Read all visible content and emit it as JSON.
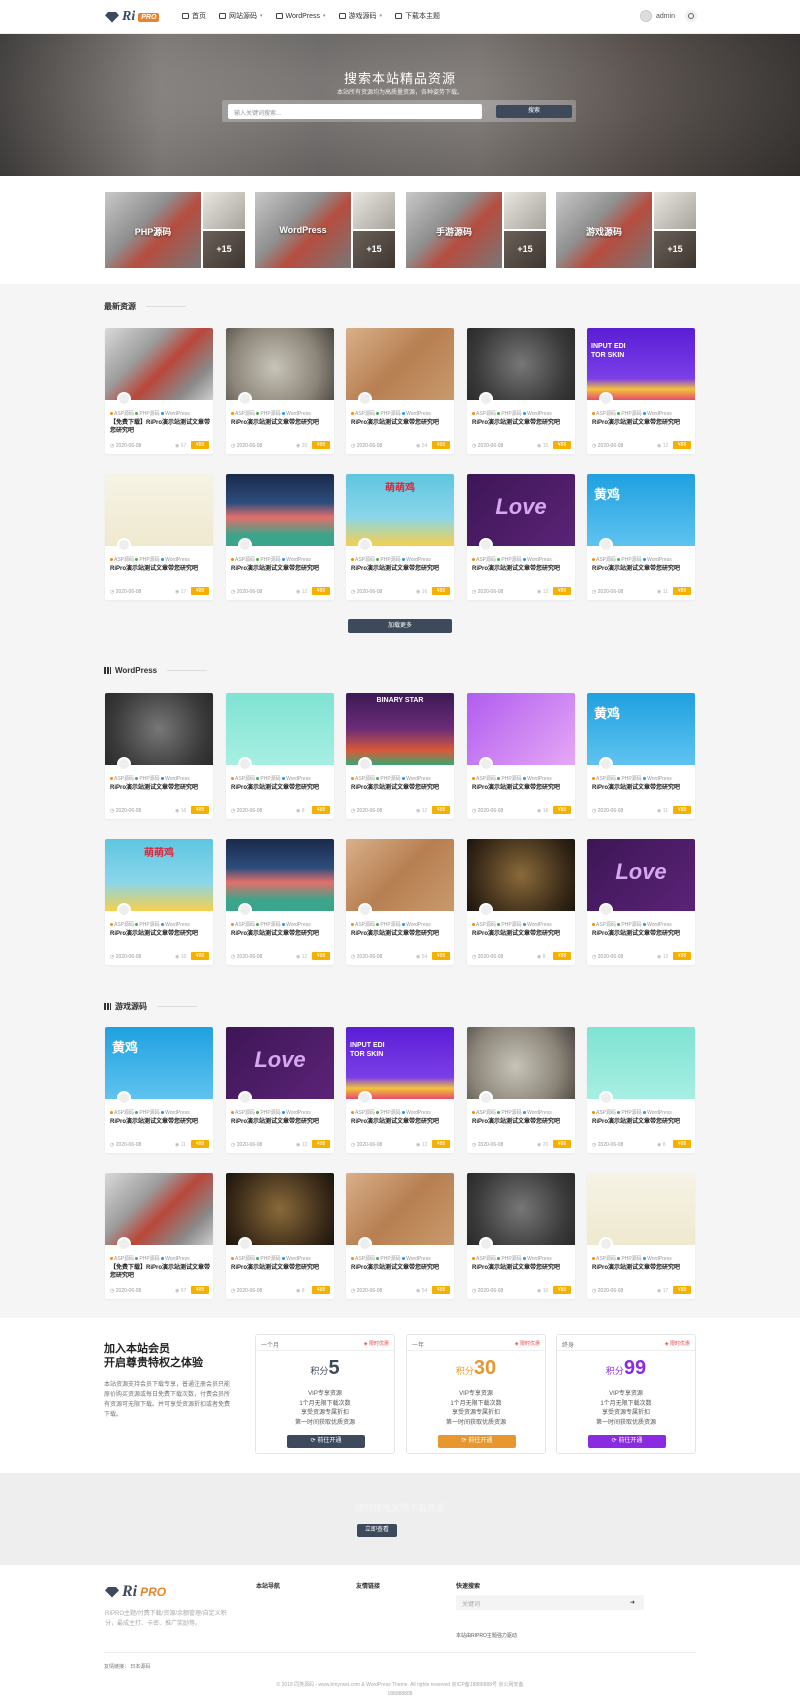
{
  "header": {
    "logo_text": "Ri",
    "logo_badge": "PRO",
    "nav": [
      {
        "label": "首页",
        "icon": "monitor-icon",
        "caret": false
      },
      {
        "label": "网站源码",
        "icon": "code-icon",
        "caret": true
      },
      {
        "label": "WordPress",
        "icon": "wordpress-icon",
        "caret": true
      },
      {
        "label": "游戏源码",
        "icon": "game-icon",
        "caret": true
      },
      {
        "label": "下载本主题",
        "icon": "pin-icon",
        "caret": false
      }
    ],
    "user": "admin"
  },
  "hero": {
    "title": "搜索本站精品资源",
    "subtitle": "本站所有资源均为高质量资源，各种姿势下载。",
    "search_placeholder": "输入关键词搜索...",
    "search_button": "搜索"
  },
  "categories": [
    {
      "name": "PHP源码",
      "more": "+15"
    },
    {
      "name": "WordPress",
      "more": "+15"
    },
    {
      "name": "手游源码",
      "more": "+15"
    },
    {
      "name": "游戏源码",
      "more": "+15"
    }
  ],
  "sections": {
    "latest": "最新资源",
    "wordpress": "WordPress",
    "games": "游戏源码",
    "load_more": "加载更多"
  },
  "card_common": {
    "tags": [
      "ASP源码",
      "PHP源码",
      "WordPress"
    ],
    "title": "RiPro演示站测试文章带您研究吧",
    "title_free": "【免费下载】RiPro演示站测试文章带您研究吧",
    "date": "2020-06-08"
  },
  "latest_cards": [
    {
      "thumb": "cans",
      "free": true,
      "views": "67",
      "price": "88"
    },
    {
      "thumb": "stamp",
      "free": false,
      "views": "20",
      "price": "88"
    },
    {
      "thumb": "wood",
      "free": false,
      "views": "54",
      "price": "88"
    },
    {
      "thumb": "emblem",
      "free": false,
      "views": "10",
      "price": "88"
    },
    {
      "thumb": "editor",
      "free": false,
      "views": "12",
      "price": "88"
    },
    {
      "thumb": "pear",
      "free": false,
      "views": "17",
      "price": "88"
    },
    {
      "thumb": "mountain",
      "free": false,
      "views": "12",
      "price": "88"
    },
    {
      "thumb": "chick",
      "free": false,
      "views": "16",
      "price": "88"
    },
    {
      "thumb": "love",
      "free": false,
      "views": "12",
      "price": "88"
    },
    {
      "thumb": "yellowchick",
      "free": false,
      "views": "11",
      "price": "88"
    }
  ],
  "wordpress_cards": [
    {
      "thumb": "emblem",
      "free": false,
      "views": "16",
      "price": "88"
    },
    {
      "thumb": "mint",
      "free": false,
      "views": "8",
      "price": "88"
    },
    {
      "thumb": "binary",
      "free": false,
      "views": "12",
      "price": "88"
    },
    {
      "thumb": "purplechick",
      "free": false,
      "views": "16",
      "price": "88"
    },
    {
      "thumb": "yellowchick",
      "free": false,
      "views": "11",
      "price": "88"
    },
    {
      "thumb": "chick",
      "free": false,
      "views": "16",
      "price": "88"
    },
    {
      "thumb": "mountain",
      "free": false,
      "views": "12",
      "price": "88"
    },
    {
      "thumb": "wood",
      "free": false,
      "views": "54",
      "price": "88"
    },
    {
      "thumb": "gold",
      "free": false,
      "views": "8",
      "price": "88"
    },
    {
      "thumb": "love",
      "free": false,
      "views": "12",
      "price": "88"
    }
  ],
  "game_cards": [
    {
      "thumb": "yellowchick",
      "free": false,
      "views": "11",
      "price": "88"
    },
    {
      "thumb": "love",
      "free": false,
      "views": "12",
      "price": "88"
    },
    {
      "thumb": "editor",
      "free": false,
      "views": "12",
      "price": "88"
    },
    {
      "thumb": "stamp",
      "free": false,
      "views": "20",
      "price": "88"
    },
    {
      "thumb": "mint",
      "free": false,
      "views": "8",
      "price": "88"
    },
    {
      "thumb": "cans",
      "free": true,
      "views": "67",
      "price": "88"
    },
    {
      "thumb": "gold",
      "free": false,
      "views": "8",
      "price": "88"
    },
    {
      "thumb": "wood",
      "free": false,
      "views": "54",
      "price": "88"
    },
    {
      "thumb": "emblem",
      "free": false,
      "views": "10",
      "price": "88"
    },
    {
      "thumb": "pear",
      "free": false,
      "views": "17",
      "price": "88"
    }
  ],
  "thumb_text": {
    "yellowchick": "黄鸡",
    "chick": "萌萌鸡",
    "editor": "INPUT EDI TOR SKIN",
    "binary": "BINARY STAR",
    "love": "Love"
  },
  "vip": {
    "title_line1": "加入本站会员",
    "title_line2": "开启尊贵特权之体验",
    "desc": "本站资源支持会员下载专享，普通注册会员只能原价购买资源或每日免费下载次数，付费会员所有资源可无限下载。并可享受资源折扣或者免费下载。",
    "plans": [
      {
        "name": "一个月",
        "badge": "限时优惠",
        "unit": "积分",
        "value": "5",
        "color": "#3d4a5c",
        "features": [
          "VIP专享资源",
          "1个月无限下载次数",
          "享受资源专属折扣",
          "第一时间获取优质资源"
        ],
        "button": "前往开通"
      },
      {
        "name": "一年",
        "badge": "限时优惠",
        "unit": "积分",
        "value": "30",
        "color": "#e8962e",
        "features": [
          "VIP专享资源",
          "1个月无限下载次数",
          "享受资源专属折扣",
          "第一时间获取优质资源"
        ],
        "button": "前往开通"
      },
      {
        "name": "终身",
        "badge": "限时优惠",
        "unit": "积分",
        "value": "99",
        "color": "#8a2be2",
        "features": [
          "VIP专享资源",
          "1个月无限下载次数",
          "享受资源专属折扣",
          "第一时间获取优质资源"
        ],
        "button": "前往开通"
      }
    ]
  },
  "promo": {
    "text": "随时随地发现下载资源",
    "button": "立即查看"
  },
  "footer": {
    "logo_text": "Ri",
    "logo_badge": "PRO",
    "desc": "RIPRO主题/付费下载/资源/余额管理/自定义积分，最成主打、卡密、推广奖励等。",
    "col1": "本站导航",
    "col2": "友情链接",
    "col3": "快速搜索",
    "search_placeholder": "关键词",
    "note": "本站由RIPRO主题强力驱动",
    "links_label": "友情链接：",
    "links_value": "日本源码",
    "copyright": "© 2018 同类源码 - www.hmyrwel.com & WordPress Theme. All rights reserved  京ICP备18888888号  京公网安备",
    "copyright2": "188888888"
  }
}
